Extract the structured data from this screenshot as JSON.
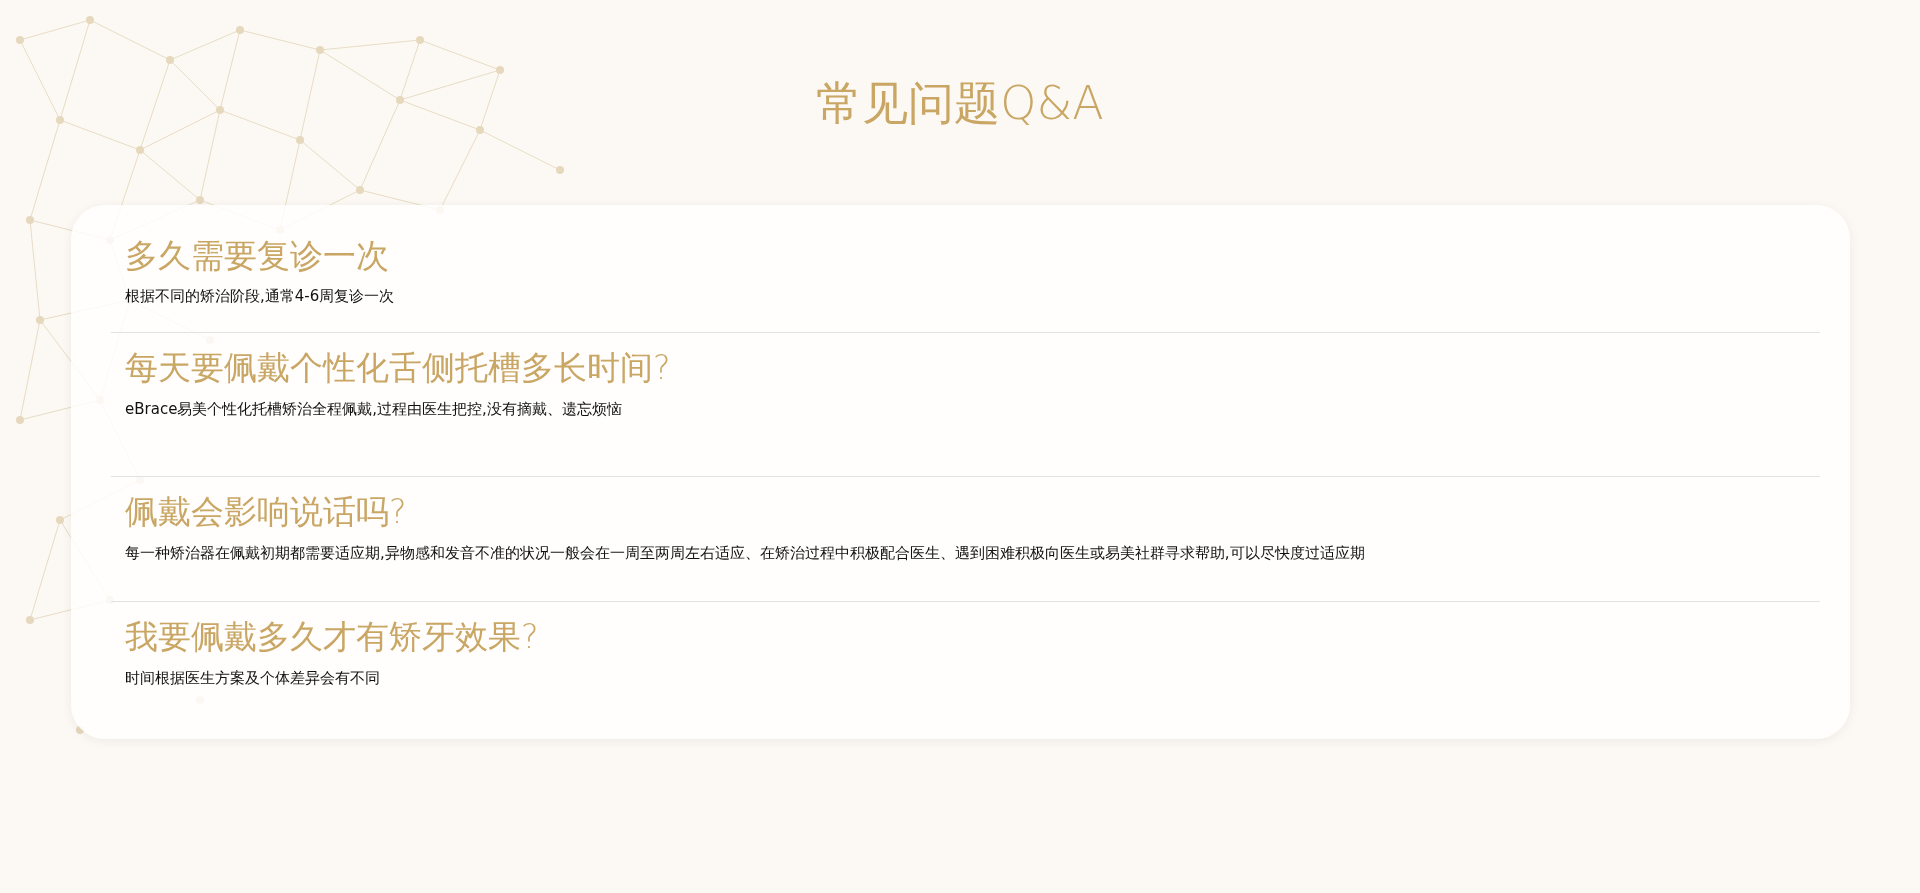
{
  "title": "常见问题Q&A",
  "faqs": [
    {
      "question": "多久需要复诊一次",
      "answer": "根据不同的矫治阶段,通常4-6周复诊一次"
    },
    {
      "question": "每天要佩戴个性化舌侧托槽多长时间?",
      "answer": "eBrace易美个性化托槽矫治全程佩戴,过程由医生把控,没有摘戴、遗忘烦恼"
    },
    {
      "question": "佩戴会影响说话吗?",
      "answer": "每一种矫治器在佩戴初期都需要适应期,异物感和发音不准的状况一般会在一周至两周左右适应、在矫治过程中积极配合医生、遇到困难积极向医生或易美社群寻求帮助,可以尽快度过适应期"
    },
    {
      "question": "我要佩戴多久才有矫牙效果?",
      "answer": "时间根据医生方案及个体差异会有不同"
    }
  ]
}
